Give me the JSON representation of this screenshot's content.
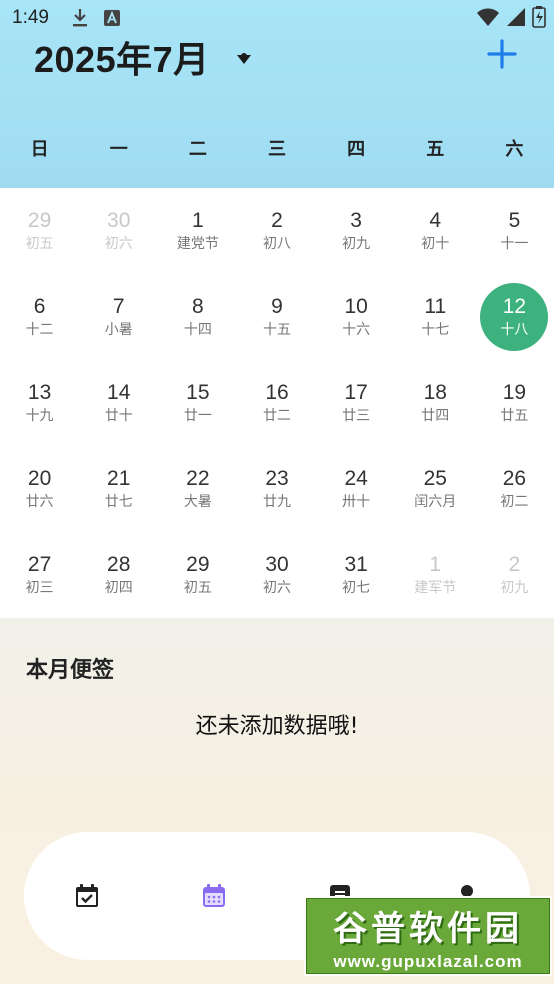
{
  "status_bar": {
    "time": "1:49"
  },
  "header": {
    "month_title": "2025年7月"
  },
  "weekdays": [
    "日",
    "一",
    "二",
    "三",
    "四",
    "五",
    "六"
  ],
  "calendar": {
    "weeks": [
      [
        {
          "day": "29",
          "lunar": "初五",
          "in_month": false
        },
        {
          "day": "30",
          "lunar": "初六",
          "in_month": false
        },
        {
          "day": "1",
          "lunar": "建党节",
          "in_month": true
        },
        {
          "day": "2",
          "lunar": "初八",
          "in_month": true
        },
        {
          "day": "3",
          "lunar": "初九",
          "in_month": true
        },
        {
          "day": "4",
          "lunar": "初十",
          "in_month": true
        },
        {
          "day": "5",
          "lunar": "十一",
          "in_month": true
        }
      ],
      [
        {
          "day": "6",
          "lunar": "十二",
          "in_month": true
        },
        {
          "day": "7",
          "lunar": "小暑",
          "in_month": true
        },
        {
          "day": "8",
          "lunar": "十四",
          "in_month": true
        },
        {
          "day": "9",
          "lunar": "十五",
          "in_month": true
        },
        {
          "day": "10",
          "lunar": "十六",
          "in_month": true
        },
        {
          "day": "11",
          "lunar": "十七",
          "in_month": true
        },
        {
          "day": "12",
          "lunar": "十八",
          "in_month": true,
          "selected": true
        }
      ],
      [
        {
          "day": "13",
          "lunar": "十九",
          "in_month": true
        },
        {
          "day": "14",
          "lunar": "廿十",
          "in_month": true
        },
        {
          "day": "15",
          "lunar": "廿一",
          "in_month": true
        },
        {
          "day": "16",
          "lunar": "廿二",
          "in_month": true
        },
        {
          "day": "17",
          "lunar": "廿三",
          "in_month": true
        },
        {
          "day": "18",
          "lunar": "廿四",
          "in_month": true
        },
        {
          "day": "19",
          "lunar": "廿五",
          "in_month": true
        }
      ],
      [
        {
          "day": "20",
          "lunar": "廿六",
          "in_month": true
        },
        {
          "day": "21",
          "lunar": "廿七",
          "in_month": true
        },
        {
          "day": "22",
          "lunar": "大暑",
          "in_month": true
        },
        {
          "day": "23",
          "lunar": "廿九",
          "in_month": true
        },
        {
          "day": "24",
          "lunar": "卅十",
          "in_month": true
        },
        {
          "day": "25",
          "lunar": "闰六月",
          "in_month": true
        },
        {
          "day": "26",
          "lunar": "初二",
          "in_month": true
        }
      ],
      [
        {
          "day": "27",
          "lunar": "初三",
          "in_month": true
        },
        {
          "day": "28",
          "lunar": "初四",
          "in_month": true
        },
        {
          "day": "29",
          "lunar": "初五",
          "in_month": true
        },
        {
          "day": "30",
          "lunar": "初六",
          "in_month": true
        },
        {
          "day": "31",
          "lunar": "初七",
          "in_month": true
        },
        {
          "day": "1",
          "lunar": "建军节",
          "in_month": false
        },
        {
          "day": "2",
          "lunar": "初九",
          "in_month": false
        }
      ]
    ],
    "selected_color": "#3db27f"
  },
  "notes": {
    "title": "本月便签",
    "empty_message": "还未添加数据哦!"
  },
  "bottom_nav": {
    "items": [
      {
        "icon": "calendar-check-icon",
        "active": false
      },
      {
        "icon": "calendar-grid-icon",
        "active": true
      },
      {
        "icon": "notes-icon",
        "active": false
      },
      {
        "icon": "profile-icon",
        "active": false
      }
    ],
    "active_color": "#8a6cf0"
  },
  "colors": {
    "accent_blue": "#1e7be8",
    "header_bg": "#a5e2f6"
  },
  "watermark": {
    "title": "谷普软件园",
    "url": "www.gupuxlazal.com"
  }
}
